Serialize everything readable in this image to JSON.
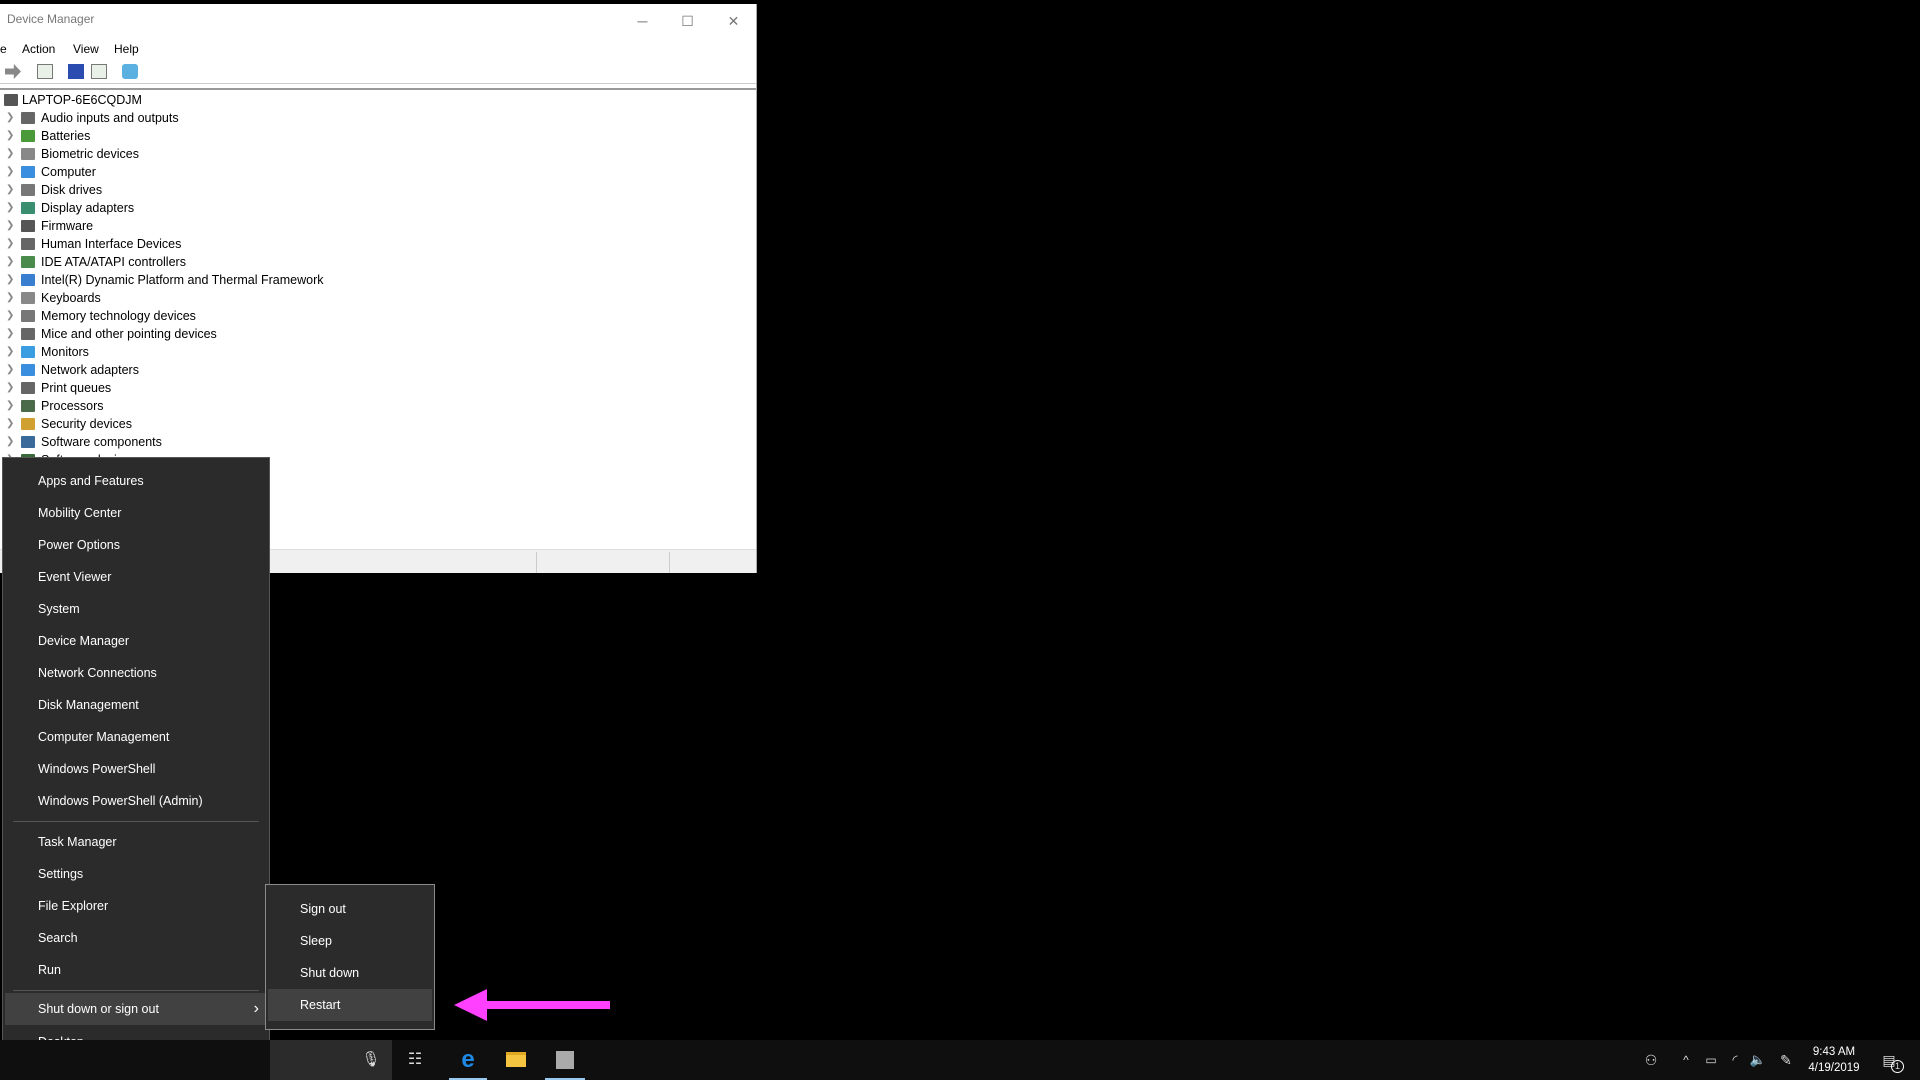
{
  "window": {
    "title": "Device Manager",
    "menu": [
      "e",
      "Action",
      "View",
      "Help"
    ],
    "controls": {
      "minimize": "─",
      "maximize": "☐",
      "close": "✕"
    }
  },
  "tree": {
    "root": "LAPTOP-6E6CQDJM",
    "items": [
      {
        "label": "Audio inputs and outputs",
        "color": "#666"
      },
      {
        "label": "Batteries",
        "color": "#4a9a3a"
      },
      {
        "label": "Biometric devices",
        "color": "#888"
      },
      {
        "label": "Computer",
        "color": "#3a8ee0"
      },
      {
        "label": "Disk drives",
        "color": "#777"
      },
      {
        "label": "Display adapters",
        "color": "#3a8e70"
      },
      {
        "label": "Firmware",
        "color": "#555"
      },
      {
        "label": "Human Interface Devices",
        "color": "#666"
      },
      {
        "label": "IDE ATA/ATAPI controllers",
        "color": "#4a8a4a"
      },
      {
        "label": "Intel(R) Dynamic Platform and Thermal Framework",
        "color": "#3a7ed0"
      },
      {
        "label": "Keyboards",
        "color": "#888"
      },
      {
        "label": "Memory technology devices",
        "color": "#777"
      },
      {
        "label": "Mice and other pointing devices",
        "color": "#666"
      },
      {
        "label": "Monitors",
        "color": "#3a9ee0"
      },
      {
        "label": "Network adapters",
        "color": "#3a8ee0"
      },
      {
        "label": "Print queues",
        "color": "#666"
      },
      {
        "label": "Processors",
        "color": "#4a6a4a"
      },
      {
        "label": "Security devices",
        "color": "#d0a030"
      },
      {
        "label": "Software components",
        "color": "#3a6a9a"
      },
      {
        "label": "Software devices",
        "color": "#3a6a3a"
      }
    ]
  },
  "context_menu": {
    "items": [
      "Apps and Features",
      "Mobility Center",
      "Power Options",
      "Event Viewer",
      "System",
      "Device Manager",
      "Network Connections",
      "Disk Management",
      "Computer Management",
      "Windows PowerShell",
      "Windows PowerShell (Admin)"
    ],
    "items2": [
      "Task Manager",
      "Settings",
      "File Explorer",
      "Search",
      "Run"
    ],
    "shutdown": "Shut down or sign out",
    "desktop": "Desktop",
    "submenu_arrow": "›"
  },
  "submenu": {
    "items": [
      "Sign out",
      "Sleep",
      "Shut down",
      "Restart"
    ],
    "highlighted": "Restart"
  },
  "annotation": {
    "arrow_color": "#ff40ff"
  },
  "taskbar": {
    "time": "9:43 AM",
    "date": "4/19/2019",
    "notification_count": "1",
    "icons": [
      "microphone-icon",
      "task-view-icon",
      "edge-icon",
      "file-explorer-icon",
      "device-manager-icon"
    ],
    "tray": [
      "people-icon",
      "chevron-up-icon",
      "battery-icon",
      "wifi-icon",
      "volume-icon",
      "pen-icon"
    ]
  }
}
